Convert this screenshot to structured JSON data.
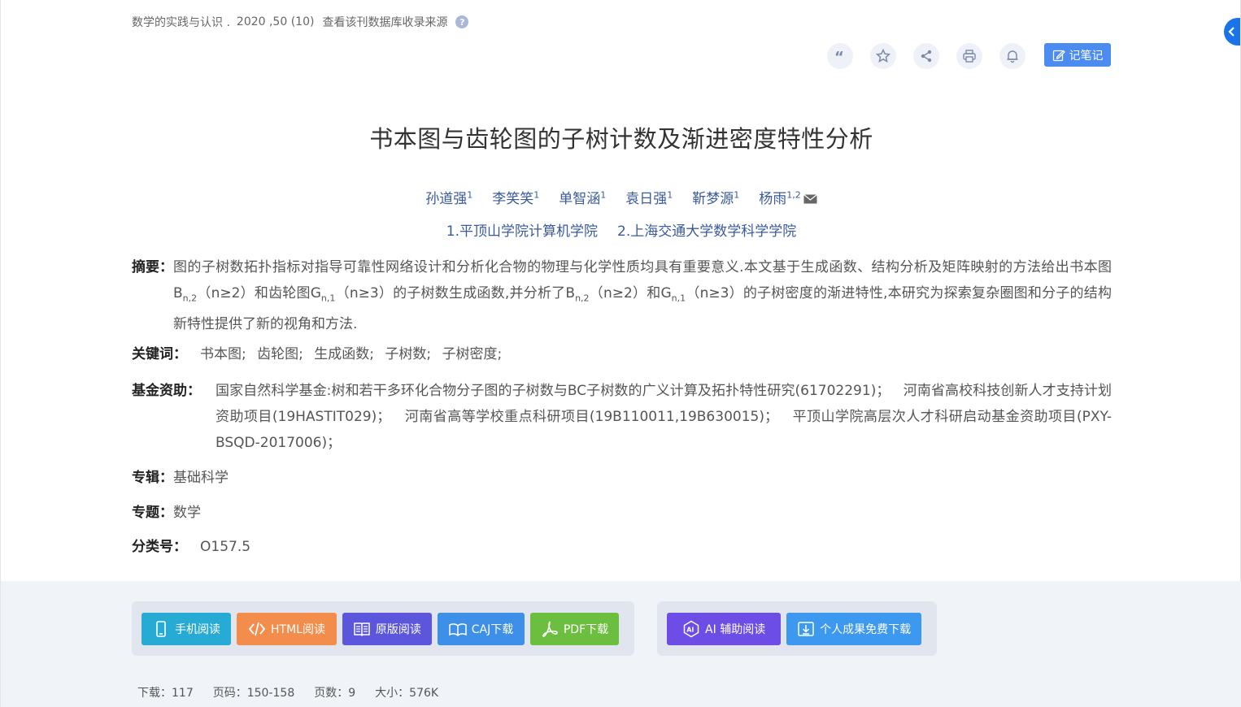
{
  "source": {
    "journal": "数学的实践与认识 .",
    "volume": "2020 ,50 (10)",
    "db_link": "查看该刊数据库收录来源",
    "help": "?"
  },
  "toolbar": {
    "icons": [
      "quote-icon",
      "star-icon",
      "share-icon",
      "print-icon",
      "bell-icon"
    ],
    "note_label": "记笔记"
  },
  "title": "书本图与齿轮图的子树计数及渐进密度特性分析",
  "authors": [
    {
      "name": "孙道强",
      "sup": "1"
    },
    {
      "name": "李笑笑",
      "sup": "1"
    },
    {
      "name": "单智涵",
      "sup": "1"
    },
    {
      "name": "袁日强",
      "sup": "1"
    },
    {
      "name": "靳梦源",
      "sup": "1"
    },
    {
      "name": "杨雨",
      "sup": "1,2"
    }
  ],
  "orgs": [
    "1.平顶山学院计算机学院",
    "2.上海交通大学数学科学学院"
  ],
  "abstract": {
    "label": "摘要：",
    "p1": "图的子树数拓扑指标对指导可靠性网络设计和分析化合物的物理与化学性质均具有重要意义.本文基于生成函数、结构分析及矩阵映射的方法给出书本图B",
    "sub1": "n,2",
    "p2": "（n≥2）和齿轮图G",
    "sub2": "n,1",
    "p3": "（n≥3）的子树数生成函数,并分析了B",
    "sub3": "n,2",
    "p4": "（n≥2）和G",
    "sub4": "n,1",
    "p5": "（n≥3）的子树密度的渐进特性,本研究为探索复杂圈图和分子的结构新特性提供了新的视角和方法."
  },
  "keywords": {
    "label": "关键词：",
    "items": [
      "书本图;",
      "齿轮图;",
      "生成函数;",
      "子树数;",
      "子树密度;"
    ]
  },
  "fund": {
    "label": "基金资助：",
    "items": [
      "国家自然科学基金:树和若干多环化合物分子图的子树数与BC子树数的广义计算及拓扑特性研究(61702291)；",
      "河南省高校科技创新人才支持计划资助项目(19HASTIT029)；",
      "河南省高等学校重点科研项目(19B110011,19B630015)；",
      "平顶山学院高层次人才科研启动基金资助项目(PXY-BSQD-2017006)；"
    ]
  },
  "zhuanji": {
    "label": "专辑：",
    "value": "基础科学"
  },
  "zhuanti": {
    "label": "专题：",
    "value": "数学"
  },
  "clc": {
    "label": "分类号：",
    "value": "O157.5"
  },
  "buttons": {
    "mobile": "手机阅读",
    "html": "HTML阅读",
    "original": "原版阅读",
    "caj": "CAJ下载",
    "pdf": "PDF下载",
    "ai": "AI 辅助阅读",
    "free": "个人成果免费下载"
  },
  "stats": {
    "downloads": "下载：117",
    "pages_range": "页码：150-158",
    "page_count": "页数：9",
    "size": "大小：576K"
  },
  "colors": {
    "link": "#3a5a9b",
    "mobile": "#27aad4",
    "html": "#f28d4b",
    "original": "#5b56dc",
    "caj": "#3d8fe8",
    "pdf": "#6cbf3e",
    "ai": "#6c4de6",
    "free": "#3d98f0"
  }
}
